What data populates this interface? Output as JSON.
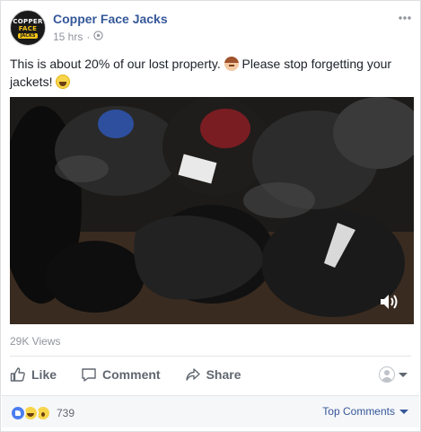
{
  "post": {
    "page_name": "Copper Face Jacks",
    "time": "15 hrs",
    "privacy_icon": "public-globe-icon",
    "avatar_lines": [
      "COPPER",
      "FACE",
      "JACKS"
    ],
    "text_part1": "This is about 20% of our lost property. ",
    "text_part2": " Please stop forgetting your jackets! ",
    "views": "29K Views"
  },
  "actions": {
    "like": "Like",
    "comment": "Comment",
    "share": "Share"
  },
  "footer": {
    "reaction_count": "739",
    "top_comments": "Top Comments"
  },
  "colors": {
    "link_blue": "#365899",
    "meta_gray": "#90949c",
    "action_gray": "#606770",
    "footer_bg": "#f6f7f9"
  }
}
